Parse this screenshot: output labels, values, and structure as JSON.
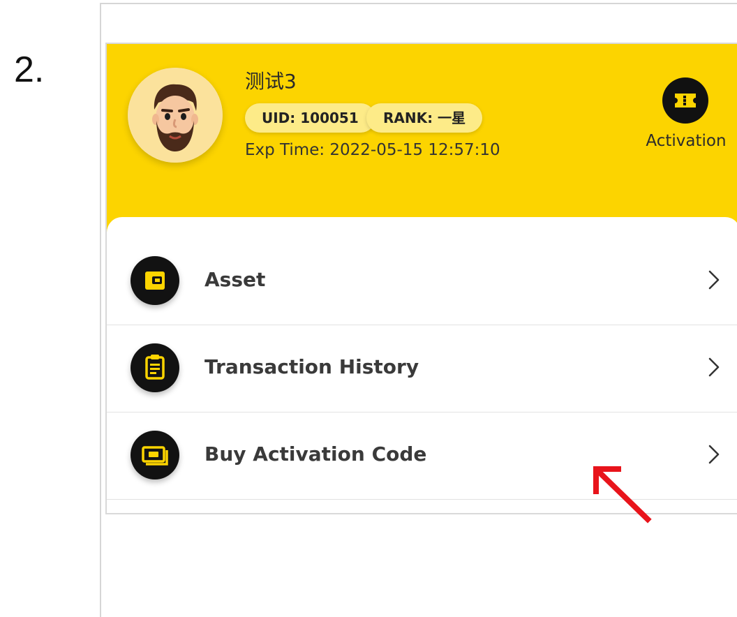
{
  "step": {
    "number": "2."
  },
  "profile": {
    "username": "测试3",
    "uid_badge": "UID: 100051",
    "rank_badge": "RANK: 一星",
    "exp_time": "Exp Time: 2022-05-15 12:57:10",
    "avatar_icon": "bearded-man-avatar"
  },
  "header_action": {
    "label": "Activation",
    "icon": "ticket-icon"
  },
  "menu": {
    "items": [
      {
        "label": "Asset",
        "icon": "wallet-icon"
      },
      {
        "label": "Transaction History",
        "icon": "clipboard-icon"
      },
      {
        "label": "Buy Activation Code",
        "icon": "banknote-icon"
      }
    ]
  },
  "annotation": {
    "icon": "red-arrow-pointing-up-left"
  },
  "colors": {
    "header_bg": "#fcd400",
    "accent": "#fcd400",
    "icon_bg": "#121212",
    "annotation": "#e8141b"
  }
}
